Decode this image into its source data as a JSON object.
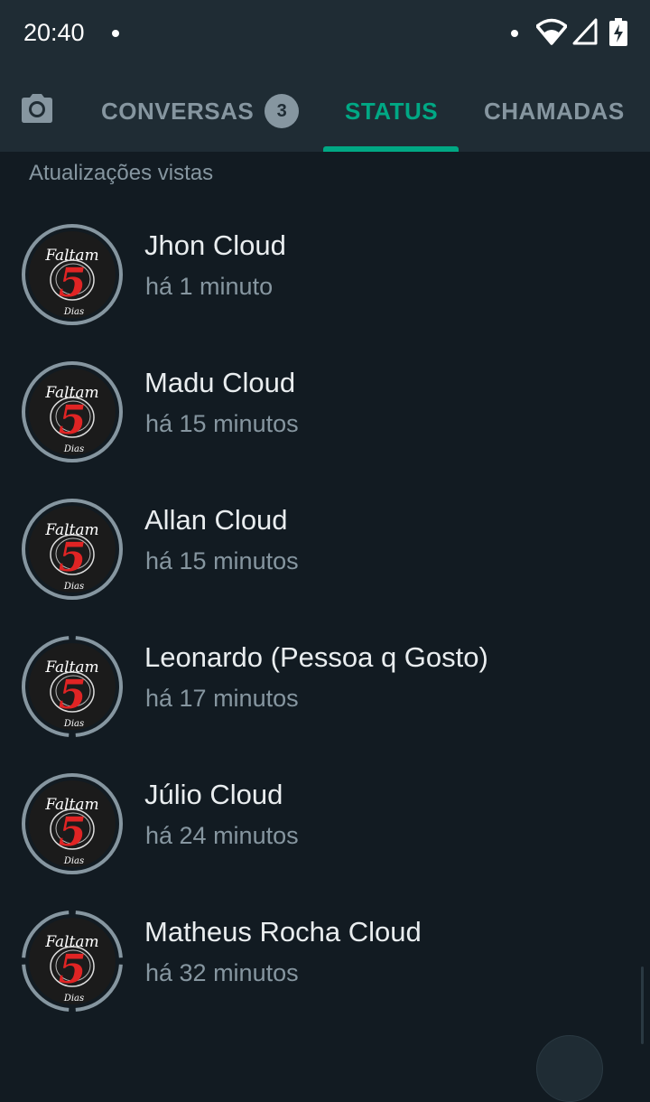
{
  "status_bar": {
    "time": "20:40",
    "icons": [
      "notification-dot",
      "wifi-icon",
      "signal-icon",
      "battery-charging-icon"
    ]
  },
  "tabs": {
    "camera_icon": "camera-icon",
    "items": [
      {
        "label": "CONVERSAS",
        "badge": "3",
        "active": false
      },
      {
        "label": "STATUS",
        "active": true
      },
      {
        "label": "CHAMADAS",
        "active": false
      }
    ],
    "active_color": "#00a884",
    "inactive_color": "#8696a0"
  },
  "section": {
    "title": "Atualizações vistas"
  },
  "statuses": [
    {
      "name": "Jhon Cloud",
      "time": "há 1 minuto",
      "segments": 1
    },
    {
      "name": "Madu Cloud",
      "time": "há 15 minutos",
      "segments": 1
    },
    {
      "name": "Allan Cloud",
      "time": "há 15 minutos",
      "segments": 1
    },
    {
      "name": "Leonardo (Pessoa q Gosto)",
      "time": "há 17 minutos",
      "segments": 2
    },
    {
      "name": "Júlio Cloud",
      "time": "há 24 minutos",
      "segments": 1
    },
    {
      "name": "Matheus Rocha Cloud",
      "time": "há 32 minutos",
      "segments": 4
    }
  ],
  "avatar": {
    "text_top": "Faltam",
    "number": "5",
    "text_bottom": "Dias"
  },
  "colors": {
    "background": "#121b22",
    "header": "#1f2c34",
    "ring": "#8696a0",
    "accent_red": "#e02424"
  }
}
